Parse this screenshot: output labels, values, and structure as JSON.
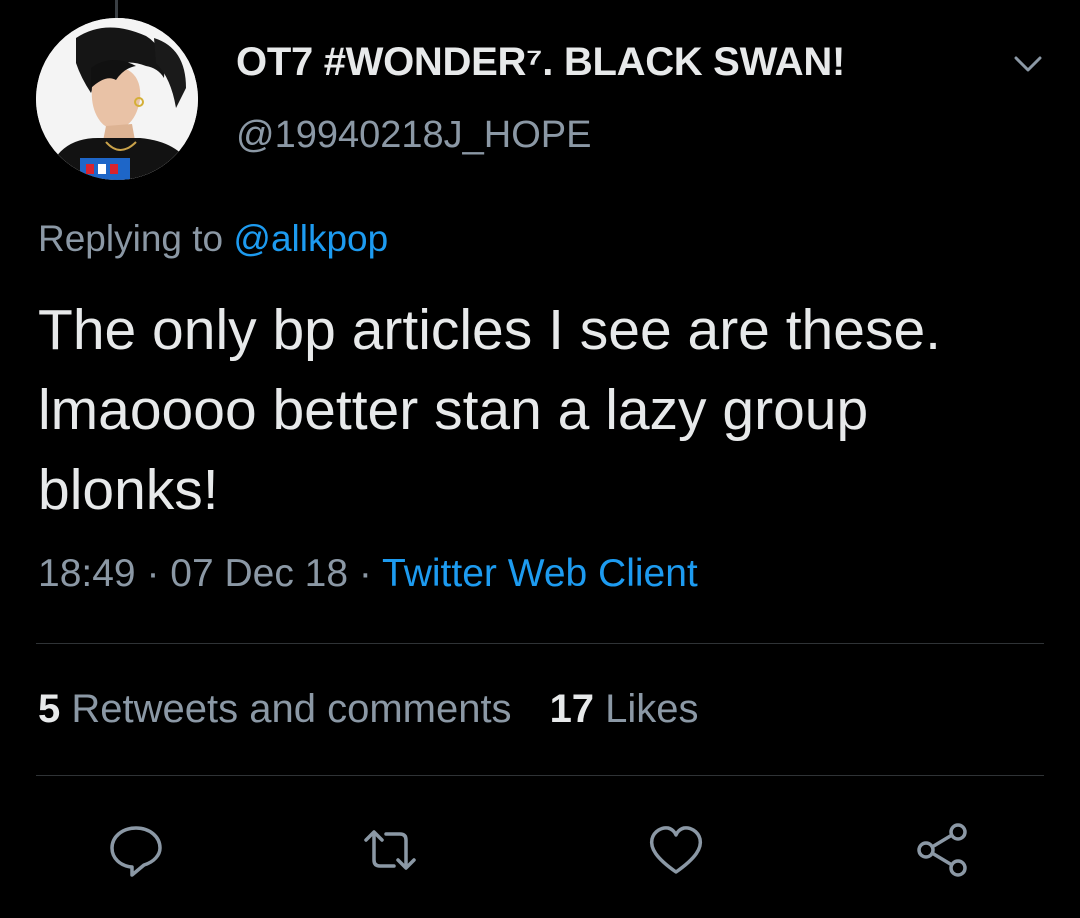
{
  "tweet": {
    "display_name": "OT7 #WONDER⁷. BLACK SWAN!",
    "handle": "@19940218J_HOPE",
    "replying_prefix": "Replying to ",
    "replying_to": "@allkpop",
    "text": "The only bp articles I see are these. lmaoooo better stan a lazy group blonks!",
    "time": "18:49",
    "separator": " · ",
    "date": "07 Dec 18",
    "client": "Twitter Web Client",
    "retweets_count": "5",
    "retweets_label": " Retweets and comments",
    "likes_count": "17",
    "likes_label": " Likes"
  },
  "icons": {
    "more": "chevron-down-icon",
    "reply": "comment-icon",
    "retweet": "retweet-icon",
    "like": "heart-icon",
    "share": "share-icon"
  },
  "colors": {
    "background": "#000000",
    "text": "#e7e9ea",
    "muted": "#8b98a5",
    "accent": "#1d9bf0",
    "divider": "#2f3336"
  }
}
